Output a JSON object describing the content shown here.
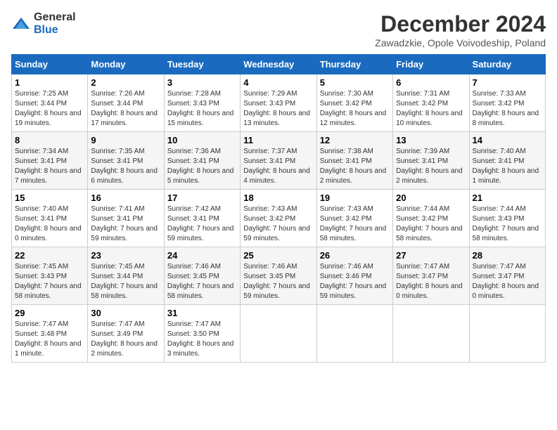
{
  "logo": {
    "text_general": "General",
    "text_blue": "Blue"
  },
  "title": "December 2024",
  "subtitle": "Zawadzkie, Opole Voivodeship, Poland",
  "headers": [
    "Sunday",
    "Monday",
    "Tuesday",
    "Wednesday",
    "Thursday",
    "Friday",
    "Saturday"
  ],
  "weeks": [
    [
      {
        "day": "1",
        "sunrise": "7:25 AM",
        "sunset": "3:44 PM",
        "daylight": "8 hours and 19 minutes."
      },
      {
        "day": "2",
        "sunrise": "7:26 AM",
        "sunset": "3:44 PM",
        "daylight": "8 hours and 17 minutes."
      },
      {
        "day": "3",
        "sunrise": "7:28 AM",
        "sunset": "3:43 PM",
        "daylight": "8 hours and 15 minutes."
      },
      {
        "day": "4",
        "sunrise": "7:29 AM",
        "sunset": "3:43 PM",
        "daylight": "8 hours and 13 minutes."
      },
      {
        "day": "5",
        "sunrise": "7:30 AM",
        "sunset": "3:42 PM",
        "daylight": "8 hours and 12 minutes."
      },
      {
        "day": "6",
        "sunrise": "7:31 AM",
        "sunset": "3:42 PM",
        "daylight": "8 hours and 10 minutes."
      },
      {
        "day": "7",
        "sunrise": "7:33 AM",
        "sunset": "3:42 PM",
        "daylight": "8 hours and 8 minutes."
      }
    ],
    [
      {
        "day": "8",
        "sunrise": "7:34 AM",
        "sunset": "3:41 PM",
        "daylight": "8 hours and 7 minutes."
      },
      {
        "day": "9",
        "sunrise": "7:35 AM",
        "sunset": "3:41 PM",
        "daylight": "8 hours and 6 minutes."
      },
      {
        "day": "10",
        "sunrise": "7:36 AM",
        "sunset": "3:41 PM",
        "daylight": "8 hours and 5 minutes."
      },
      {
        "day": "11",
        "sunrise": "7:37 AM",
        "sunset": "3:41 PM",
        "daylight": "8 hours and 4 minutes."
      },
      {
        "day": "12",
        "sunrise": "7:38 AM",
        "sunset": "3:41 PM",
        "daylight": "8 hours and 2 minutes."
      },
      {
        "day": "13",
        "sunrise": "7:39 AM",
        "sunset": "3:41 PM",
        "daylight": "8 hours and 2 minutes."
      },
      {
        "day": "14",
        "sunrise": "7:40 AM",
        "sunset": "3:41 PM",
        "daylight": "8 hours and 1 minute."
      }
    ],
    [
      {
        "day": "15",
        "sunrise": "7:40 AM",
        "sunset": "3:41 PM",
        "daylight": "8 hours and 0 minutes."
      },
      {
        "day": "16",
        "sunrise": "7:41 AM",
        "sunset": "3:41 PM",
        "daylight": "7 hours and 59 minutes."
      },
      {
        "day": "17",
        "sunrise": "7:42 AM",
        "sunset": "3:41 PM",
        "daylight": "7 hours and 59 minutes."
      },
      {
        "day": "18",
        "sunrise": "7:43 AM",
        "sunset": "3:42 PM",
        "daylight": "7 hours and 59 minutes."
      },
      {
        "day": "19",
        "sunrise": "7:43 AM",
        "sunset": "3:42 PM",
        "daylight": "7 hours and 58 minutes."
      },
      {
        "day": "20",
        "sunrise": "7:44 AM",
        "sunset": "3:42 PM",
        "daylight": "7 hours and 58 minutes."
      },
      {
        "day": "21",
        "sunrise": "7:44 AM",
        "sunset": "3:43 PM",
        "daylight": "7 hours and 58 minutes."
      }
    ],
    [
      {
        "day": "22",
        "sunrise": "7:45 AM",
        "sunset": "3:43 PM",
        "daylight": "7 hours and 58 minutes."
      },
      {
        "day": "23",
        "sunrise": "7:45 AM",
        "sunset": "3:44 PM",
        "daylight": "7 hours and 58 minutes."
      },
      {
        "day": "24",
        "sunrise": "7:46 AM",
        "sunset": "3:45 PM",
        "daylight": "7 hours and 58 minutes."
      },
      {
        "day": "25",
        "sunrise": "7:46 AM",
        "sunset": "3:45 PM",
        "daylight": "7 hours and 59 minutes."
      },
      {
        "day": "26",
        "sunrise": "7:46 AM",
        "sunset": "3:46 PM",
        "daylight": "7 hours and 59 minutes."
      },
      {
        "day": "27",
        "sunrise": "7:47 AM",
        "sunset": "3:47 PM",
        "daylight": "8 hours and 0 minutes."
      },
      {
        "day": "28",
        "sunrise": "7:47 AM",
        "sunset": "3:47 PM",
        "daylight": "8 hours and 0 minutes."
      }
    ],
    [
      {
        "day": "29",
        "sunrise": "7:47 AM",
        "sunset": "3:48 PM",
        "daylight": "8 hours and 1 minute."
      },
      {
        "day": "30",
        "sunrise": "7:47 AM",
        "sunset": "3:49 PM",
        "daylight": "8 hours and 2 minutes."
      },
      {
        "day": "31",
        "sunrise": "7:47 AM",
        "sunset": "3:50 PM",
        "daylight": "8 hours and 3 minutes."
      },
      null,
      null,
      null,
      null
    ]
  ]
}
